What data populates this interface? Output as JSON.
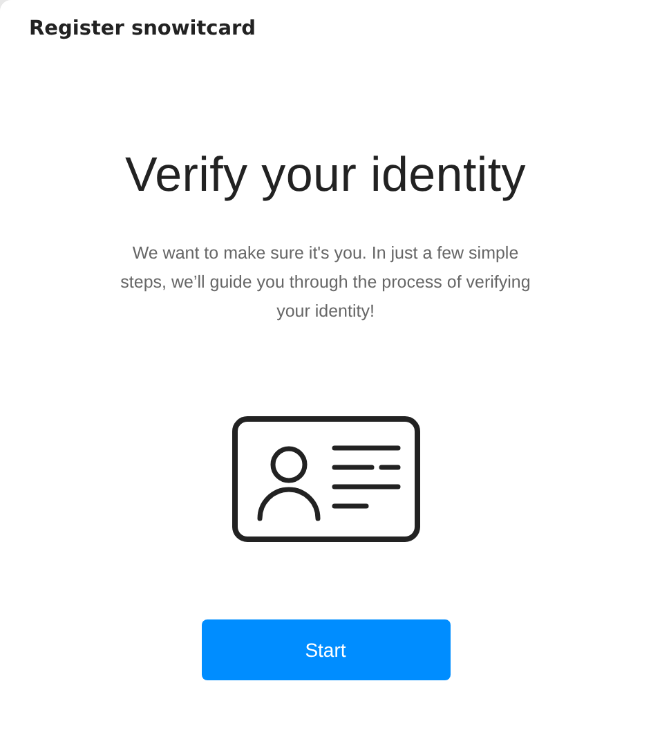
{
  "window": {
    "title": "Register snowitcard"
  },
  "heading": "Verify your identity",
  "description": "We want to make sure it's you. In just a few simple steps, we’ll guide you through the process of verifying your identity!",
  "buttons": [
    "Start"
  ]
}
